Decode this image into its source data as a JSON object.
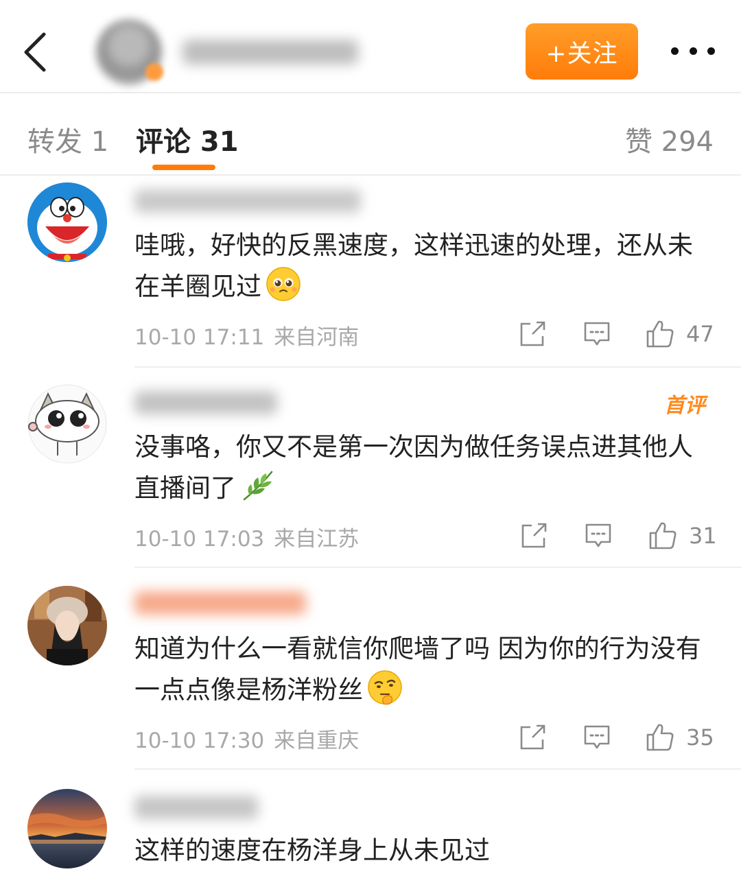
{
  "header": {
    "follow_label": "+关注"
  },
  "tabs": {
    "repost": "转发 1",
    "comment": "评论 31",
    "like": "赞 294"
  },
  "comments": [
    {
      "text": "哇哦，好快的反黑速度，这样迅速的处理，还从未在羊圈见过",
      "emoji": "pleading-face-icon",
      "time": "10-10 17:11",
      "location": "来自河南",
      "likes": "47"
    },
    {
      "badge": "首评",
      "text": "没事咯，你又不是第一次因为做任务误点进其他人直播间了",
      "emoji": "leaf-sprig-icon",
      "time": "10-10 17:03",
      "location": "来自江苏",
      "likes": "31"
    },
    {
      "text": "知道为什么一看就信你爬墙了吗 因为你的行为没有一点点像是杨洋粉丝",
      "emoji": "thinking-face-icon",
      "time": "10-10 17:30",
      "location": "来自重庆",
      "likes": "35"
    },
    {
      "text": "这样的速度在杨洋身上从未见过"
    }
  ],
  "colors": {
    "accent": "#ff7c0a",
    "meta_gray": "#a8a8a8"
  }
}
